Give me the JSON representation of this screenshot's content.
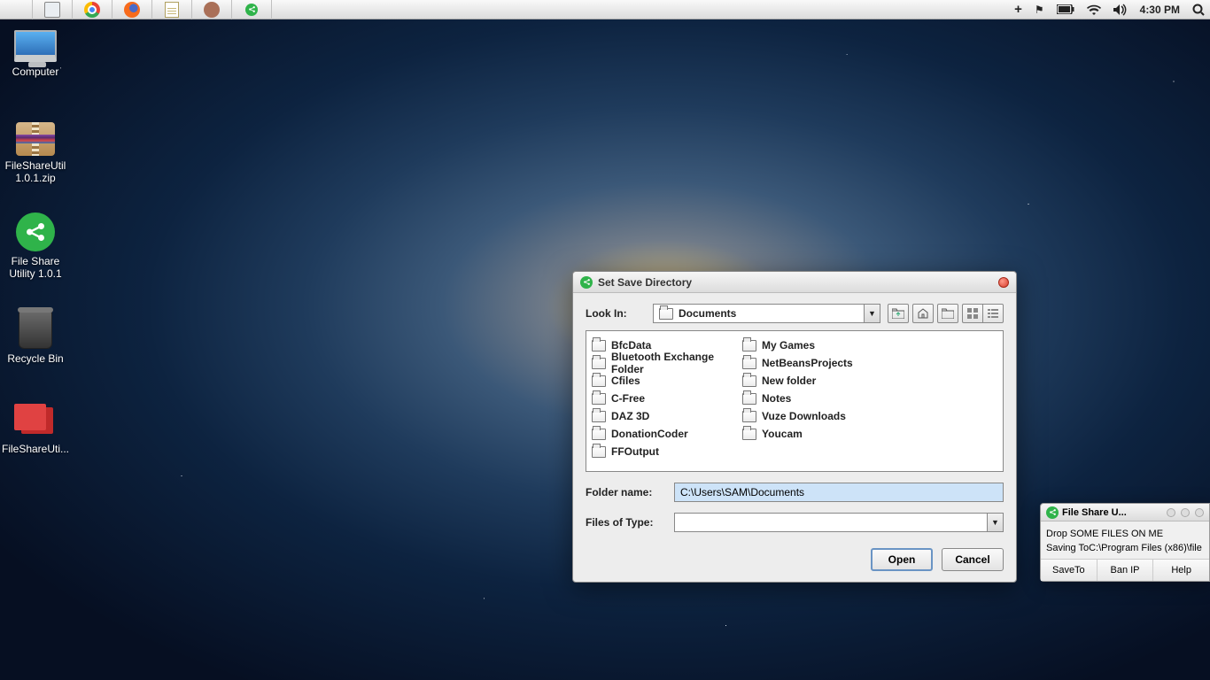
{
  "menubar": {
    "clock": "4:30 PM"
  },
  "desktop": {
    "computer": "Computer",
    "zip": "FileShareUtil 1.0.1.zip",
    "share": "File Share Utility 1.0.1",
    "bin": "Recycle Bin",
    "vm": "FileShareUti..."
  },
  "dialog": {
    "title": "Set Save Directory",
    "lookin_label": "Look In:",
    "lookin_value": "Documents",
    "folders": [
      "BfcData",
      "Bluetooth Exchange Folder",
      "Cfiles",
      "C-Free",
      "DAZ 3D",
      "DonationCoder",
      "FFOutput",
      "My Games",
      "NetBeansProjects",
      "New folder",
      "Notes",
      "Vuze Downloads",
      "Youcam"
    ],
    "folder_name_label": "Folder name:",
    "folder_name_value": "C:\\Users\\SAM\\Documents",
    "filetype_label": "Files of Type:",
    "open": "Open",
    "cancel": "Cancel"
  },
  "floater": {
    "title": "File Share U...",
    "line1": "Drop SOME FILES ON ME",
    "line2": "Saving ToC:\\Program Files (x86)\\file",
    "b1": "SaveTo",
    "b2": "Ban IP",
    "b3": "Help"
  }
}
